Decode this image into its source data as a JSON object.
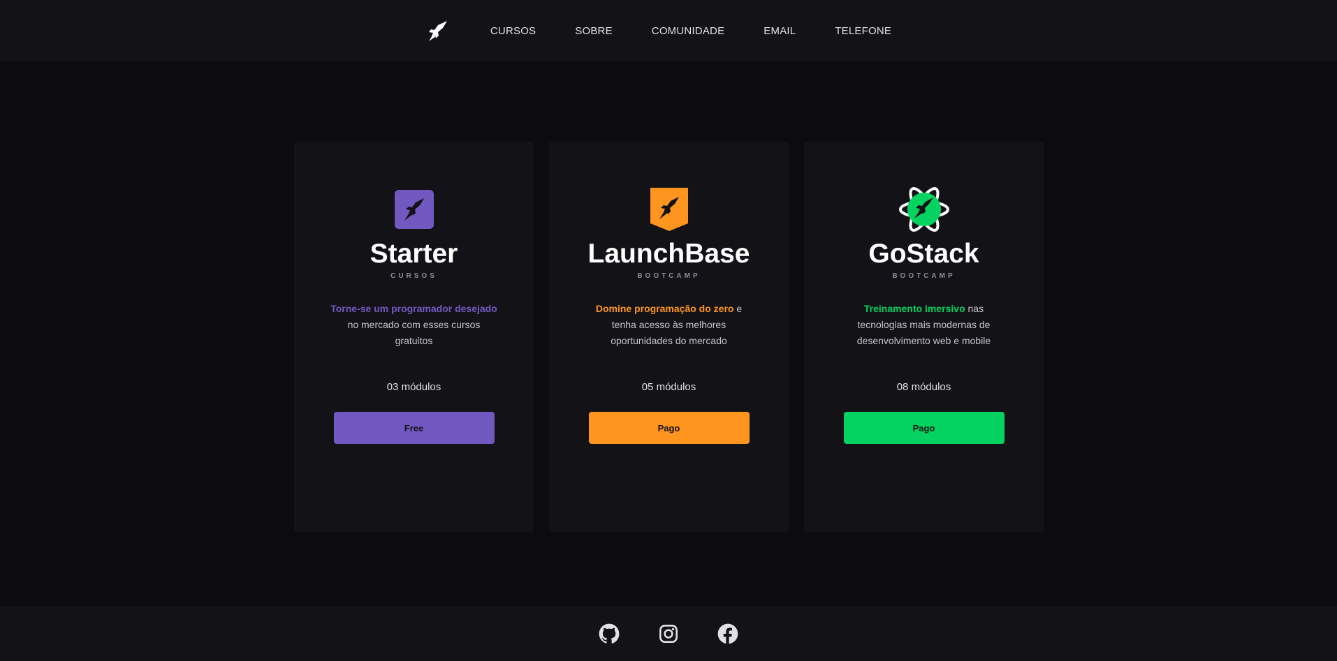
{
  "nav": {
    "logo_icon": "rocket-icon",
    "items": [
      "CURSOS",
      "SOBRE",
      "COMUNIDADE",
      "EMAIL",
      "TELEFONE"
    ]
  },
  "cards": [
    {
      "title": "Starter",
      "subtitle": "CURSOS",
      "icon": "rocket-square-icon",
      "accent": "#7159c1",
      "highlight": "Torne-se um programador desejado",
      "description": "no mercado com esses cursos gratuitos",
      "modules": "03 módulos",
      "button": "Free"
    },
    {
      "title": "LaunchBase",
      "subtitle": "BOOTCAMP",
      "icon": "rocket-shield-icon",
      "accent": "#fd951f",
      "highlight": "Domine programação do zero",
      "description": "e tenha acesso às melhores oportunidades do mercado",
      "modules": "05 módulos",
      "button": "Pago"
    },
    {
      "title": "GoStack",
      "subtitle": "BOOTCAMP",
      "icon": "rocket-atom-icon",
      "accent": "#04d361",
      "highlight": "Treinamento imersivo",
      "description": "nas tecnologias mais modernas de desenvolvimento web e mobile",
      "modules": "08 módulos",
      "button": "Pago"
    }
  ],
  "footer": {
    "icons": [
      "github-icon",
      "instagram-icon",
      "facebook-icon"
    ]
  }
}
